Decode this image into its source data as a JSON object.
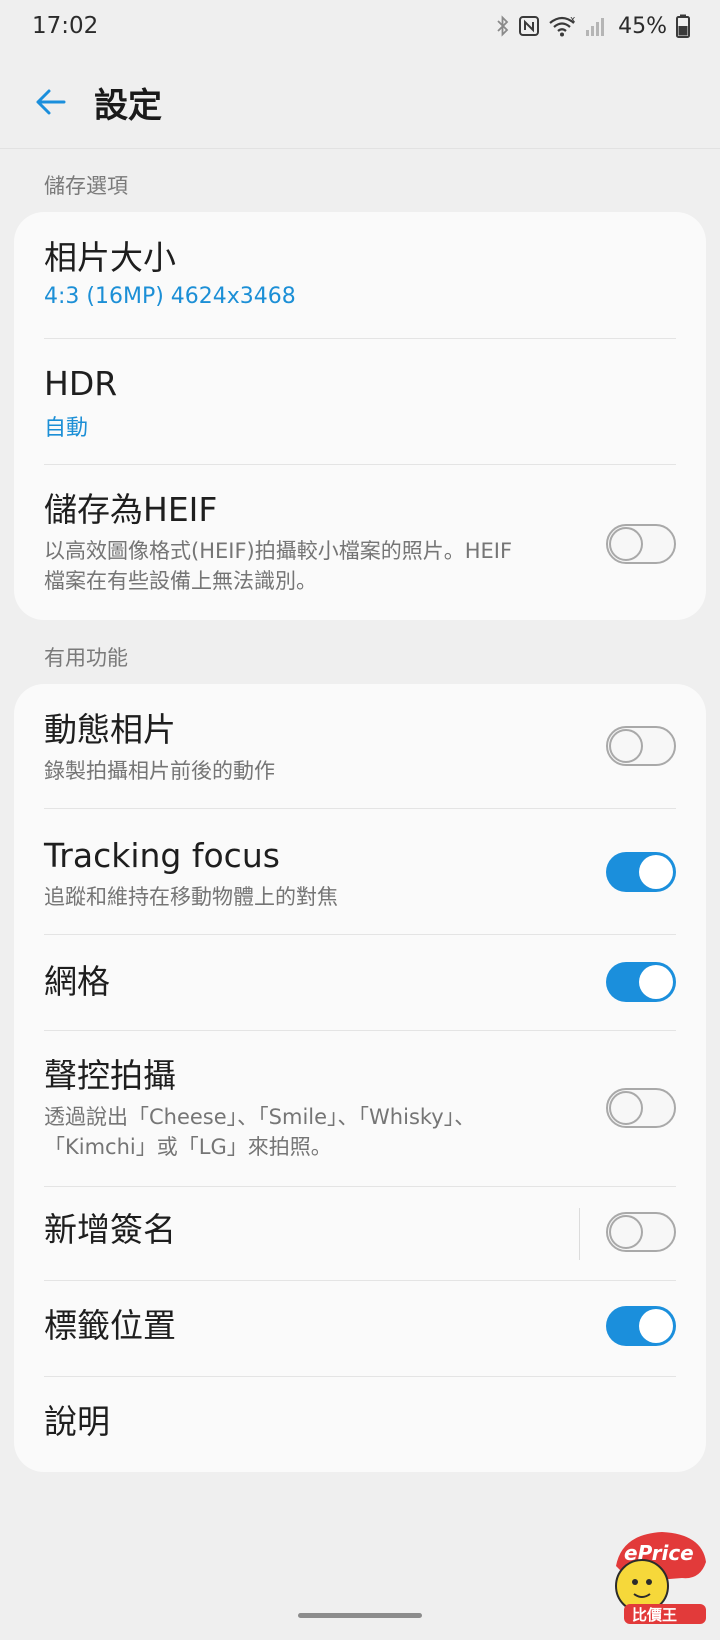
{
  "status_bar": {
    "time": "17:02",
    "battery": "45%",
    "icons": [
      "bluetooth-icon",
      "nfc-icon",
      "wifi-icon",
      "signal-icon",
      "battery-icon"
    ]
  },
  "app_bar": {
    "title": "設定",
    "back_icon": "arrow-left-icon"
  },
  "colors": {
    "accent": "#1b8fdc",
    "background": "#efefef",
    "card": "#fafafa"
  },
  "sections": {
    "storage": {
      "header": "儲存選項",
      "items": {
        "picture_size": {
          "title": "相片大小",
          "value": "4:3 (16MP) 4624x3468"
        },
        "hdr": {
          "title": "HDR",
          "value": "自動"
        },
        "save_heif": {
          "title": "儲存為HEIF",
          "desc_line1": "以高效圖像格式(HEIF)拍攝較小檔案的照片。HEIF",
          "desc_line2": "檔案在有些設備上無法識別。",
          "enabled": false
        }
      }
    },
    "useful": {
      "header": "有用功能",
      "items": {
        "motion_photo": {
          "title": "動態相片",
          "desc": "錄製拍攝相片前後的動作",
          "enabled": false
        },
        "tracking_focus": {
          "title": "Tracking focus",
          "desc": "追蹤和維持在移動物體上的對焦",
          "enabled": true
        },
        "grid": {
          "title": "網格",
          "enabled": true
        },
        "voice_shutter": {
          "title": "聲控拍攝",
          "desc_line1": "透過說出「Cheese」、「Smile」、「Whisky」、",
          "desc_line2": "「Kimchi」或「LG」來拍照。",
          "enabled": false
        },
        "add_signature": {
          "title": "新增簽名",
          "enabled": false
        },
        "tag_location": {
          "title": "標籤位置",
          "enabled": true
        },
        "help": {
          "title": "說明"
        }
      }
    }
  },
  "watermark": {
    "text_top": "ePrice",
    "text_bottom": "比價王"
  }
}
